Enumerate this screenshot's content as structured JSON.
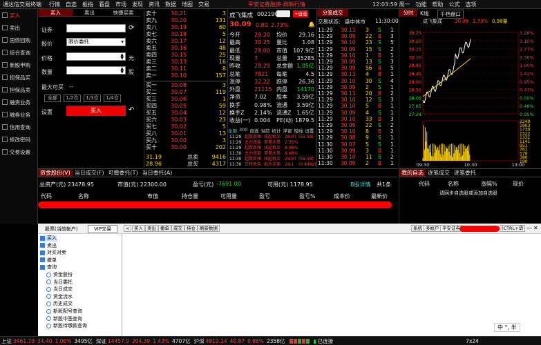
{
  "topbar": {
    "app_title": "通达信交易终端",
    "menus": [
      "行情",
      "自选",
      "板指",
      "看盘",
      "市场",
      "发现",
      "资讯",
      "数据",
      "地图",
      "交易"
    ],
    "center_text": "平安证券融资-刷新行情",
    "time": "12:03:59 周一",
    "right_menus": [
      "功能",
      "帮助",
      "公式",
      "选项"
    ]
  },
  "leftnav": {
    "items": [
      "买入",
      "卖出",
      "国债回购",
      "综合查询",
      "新股申购",
      "担保品买",
      "担保品卖",
      "融资业务",
      "融券业务",
      "信用查询",
      "修改密码",
      "交易设置"
    ]
  },
  "order": {
    "tabs": [
      "买入",
      "卖出",
      "快捷买卖"
    ],
    "security_label": "证券",
    "price_type_label": "报价",
    "price_type_value": "限价委托",
    "price_label": "价格",
    "price_unit": "元",
    "qty_label": "数量",
    "qty_unit": "股",
    "max_label": "最大可买",
    "max_value": "--",
    "quick": [
      "全部",
      "1/2仓",
      "1/3仓",
      "1/4仓"
    ],
    "settings_label": "设置",
    "buy_label": "买入"
  },
  "book": {
    "asks": [
      [
        "卖十",
        "30.21",
        "3"
      ],
      [
        "卖九",
        "30.20",
        "131"
      ],
      [
        "卖八",
        "30.19",
        "60"
      ],
      [
        "卖七",
        "30.18",
        "5"
      ],
      [
        "卖六",
        "30.17",
        "12"
      ],
      [
        "卖五",
        "30.16",
        "48"
      ],
      [
        "卖四",
        "30.15",
        "25"
      ],
      [
        "卖三",
        "30.13",
        "16"
      ],
      [
        "卖二",
        "30.11",
        "8"
      ],
      [
        "卖一",
        "30.10",
        "157"
      ]
    ],
    "bids": [
      [
        "买一",
        "30.08",
        "3"
      ],
      [
        "买二",
        "30.07",
        "119"
      ],
      [
        "买三",
        "30.06",
        "1"
      ],
      [
        "买四",
        "30.05",
        "59"
      ],
      [
        "买五",
        "30.04",
        "12"
      ],
      [
        "买六",
        "30.03",
        "23"
      ],
      [
        "买七",
        "30.02",
        "5"
      ],
      [
        "买八",
        "30.01",
        "13"
      ],
      [
        "买九",
        "30.00",
        "3"
      ],
      [
        "买十",
        "30.00",
        "202"
      ]
    ],
    "total_ask_label": "总卖",
    "total_ask": "9416",
    "total_bid_label": "总买",
    "total_bid": "4317",
    "avg_ask": "31.19",
    "avg_bid": "28.96",
    "ask_avg_label": "卖均",
    "bid_avg_label": "买均"
  },
  "quote": {
    "name": "成飞集成",
    "code": "002190",
    "price": "30.09",
    "change": "0.80",
    "pct": "2.73%",
    "add_label": "+自选",
    "rows": [
      [
        "今开",
        "29.20",
        "均价",
        "29.16"
      ],
      [
        "最高",
        "30.25",
        "量比",
        "1.08"
      ],
      [
        "最低",
        "29.00",
        "市值",
        "107.9亿"
      ],
      [
        "现量",
        "7",
        "总量",
        "35285"
      ],
      [
        "昨收",
        "29.29",
        "总金额",
        "1.05亿"
      ],
      [
        "总笔",
        "7821",
        "每笔",
        "4.5"
      ],
      [
        "涨停",
        "32.22",
        "跌停",
        "26.36"
      ],
      [
        "外盘",
        "21115",
        "内盘",
        "14170"
      ],
      [
        "净资",
        "7.02",
        "股本",
        "3.59亿"
      ],
      [
        "换手",
        "0.98%",
        "流通",
        "3.59亿"
      ],
      [
        "换手Z",
        "2.14%",
        "流通Z",
        "1.65亿"
      ],
      [
        "收益(一)",
        "0.004",
        "PE(动)",
        "1879.5"
      ]
    ],
    "subtabs": [
      "全部",
      "300",
      "自选",
      "当前",
      "统计",
      "浮窗",
      "短线",
      "设置"
    ],
    "news": [
      [
        "11:29",
        "超跌反弹",
        "排起机买",
        "28.07",
        "(59.59)"
      ],
      [
        "11:29",
        "主力资金",
        "单笔大单",
        "2.35%",
        ""
      ],
      [
        "11:29",
        "超跌反弹",
        "排起机买",
        "8.06%",
        ""
      ],
      [
        "11:30",
        "主力资金",
        "单笔大单",
        "8.68%",
        ""
      ],
      [
        "11:30",
        "超跌反弹",
        "排起机买",
        "28.07",
        "(59.59)"
      ],
      [
        "11:30",
        "正特免杂",
        "纸大买卖",
        "24.1",
        "(0.8492)"
      ]
    ]
  },
  "trades": {
    "tab": "分笔成交",
    "status_label": "交易状态:",
    "status": "盘中休市",
    "status_time": "11:30:00",
    "rows": [
      [
        "11:29",
        "30.11",
        "3",
        "S",
        "1"
      ],
      [
        "11:29",
        "30.09",
        "22",
        "B",
        "3"
      ],
      [
        "11:29",
        "30.10",
        "23",
        "S",
        "5"
      ],
      [
        "11:29",
        "30.09",
        "15",
        "S",
        "2"
      ],
      [
        "11:29",
        "30.10",
        "1",
        "B",
        "1"
      ],
      [
        "11:29",
        "30.09",
        "13",
        "S",
        "3"
      ],
      [
        "11:29",
        "30.09",
        "56",
        "B",
        "5"
      ],
      [
        "11:29",
        "30.11",
        "4",
        "B",
        "1"
      ],
      [
        "11:29",
        "30.10",
        "30",
        "S",
        "4"
      ],
      [
        "11:29",
        "30.09",
        "2",
        "S",
        "1"
      ],
      [
        "11:29",
        "30.11",
        "20",
        "B",
        "2"
      ],
      [
        "11:29",
        "30.10",
        "12",
        "S",
        "3"
      ],
      [
        "11:29",
        "30.10",
        "5",
        "B",
        "1"
      ],
      [
        "11:29",
        "30.09",
        "4",
        "S",
        "1"
      ],
      [
        "11:29",
        "30.10",
        "33",
        "B",
        "3"
      ],
      [
        "11:29",
        "30.09",
        "22",
        "S",
        "2"
      ],
      [
        "11:29",
        "30.10",
        "8",
        "B",
        "2"
      ],
      [
        "11:29",
        "30.08",
        "9",
        "S",
        "1"
      ],
      [
        "11:30",
        "30.07",
        "5",
        "S",
        "1"
      ],
      [
        "11:30",
        "30.09",
        "3",
        "B",
        "1"
      ],
      [
        "11:30",
        "30.10",
        "11",
        "S",
        "2"
      ],
      [
        "11:30",
        "30.09",
        "2",
        "B",
        "1"
      ]
    ]
  },
  "chart": {
    "tabs": [
      "分时",
      "K线",
      "千档盘口"
    ],
    "name": "成飞集成",
    "price": "30.09",
    "pct": "2.73%",
    "vol_label": "0.98量",
    "prices": [
      "30.25",
      "30.20",
      "30.15",
      "30.10",
      "29.85",
      "29.45",
      "29.00",
      "28.55",
      "28.05",
      "27.65",
      "27.24"
    ],
    "pcts": [
      "3.28%",
      "3.10%",
      "2.77%",
      "2.36%",
      "1.90%",
      "1.42%",
      "0.95%",
      "0.47%",
      "0.00%",
      "0.48%",
      "0.95%"
    ],
    "vols": [
      "2249",
      "1903",
      "1730",
      "1522",
      "1331",
      "1141",
      "951",
      "761",
      "570",
      "380",
      "190"
    ],
    "times": [
      "09:30",
      "10:30",
      "13:00"
    ]
  },
  "holdings": {
    "tabs": [
      "资金股份(V)",
      "当日成交(F)",
      "可撤委托(T)",
      "当日委托(A)"
    ],
    "total_asset": "总资产(元) 23478.95",
    "market_value": "市值(元) 22300.00",
    "pnl_label": "盈亏(元)",
    "pnl": "-7691.00",
    "available": "可用(元) 1178.95",
    "detail_label": "B股详情",
    "pages": "共1条",
    "cols": [
      "代码",
      "名称",
      "市值",
      "持仓量",
      "可用量",
      "盈亏",
      "盈亏%",
      "成本价",
      "最新价"
    ]
  },
  "watch": {
    "tabs": [
      "我的自选",
      "逐笔成交",
      "逐笔委托"
    ],
    "cols": [
      "代码",
      "名称",
      "涨幅%",
      "现价"
    ],
    "empty": "请网步自选股或添加自选股"
  },
  "bottom": {
    "left_title": "股票(当前帐户)",
    "vip_label": "VIP交易",
    "tool_buttons": [
      "买入",
      "卖出",
      "撤单",
      "成交",
      "持仓",
      "刷新数据"
    ],
    "right_buttons": [
      "系统",
      "多帐户",
      "平安证券"
    ],
    "ctrl": "(CTRL+1)",
    "tree": [
      "买入",
      "卖出",
      "对买对卖",
      "撤单",
      "查询",
      "资金股份",
      "当日委托",
      "当日成交",
      "资金流水",
      "历史成交",
      "新股配号查询",
      "新股中签查询",
      "新股待缴款查询"
    ],
    "ime": "中 °, 半"
  },
  "status": {
    "sh_label": "上证",
    "sh": "3461.73",
    "sh_chg": "34.40",
    "sh_pct": "1.00%",
    "sh_amt": "3495亿",
    "sz_label": "深证",
    "sz": "14457.9",
    "sz_chg": "204.39",
    "sz_pct": "1.43%",
    "sz_amt": "4707亿",
    "hs_label": "沪深",
    "hs": "4810.14",
    "hs_chg": "40.87",
    "hs_pct": "0.86%",
    "hs_amt": "2358亿",
    "conn": "已连接",
    "right": "7x24"
  }
}
